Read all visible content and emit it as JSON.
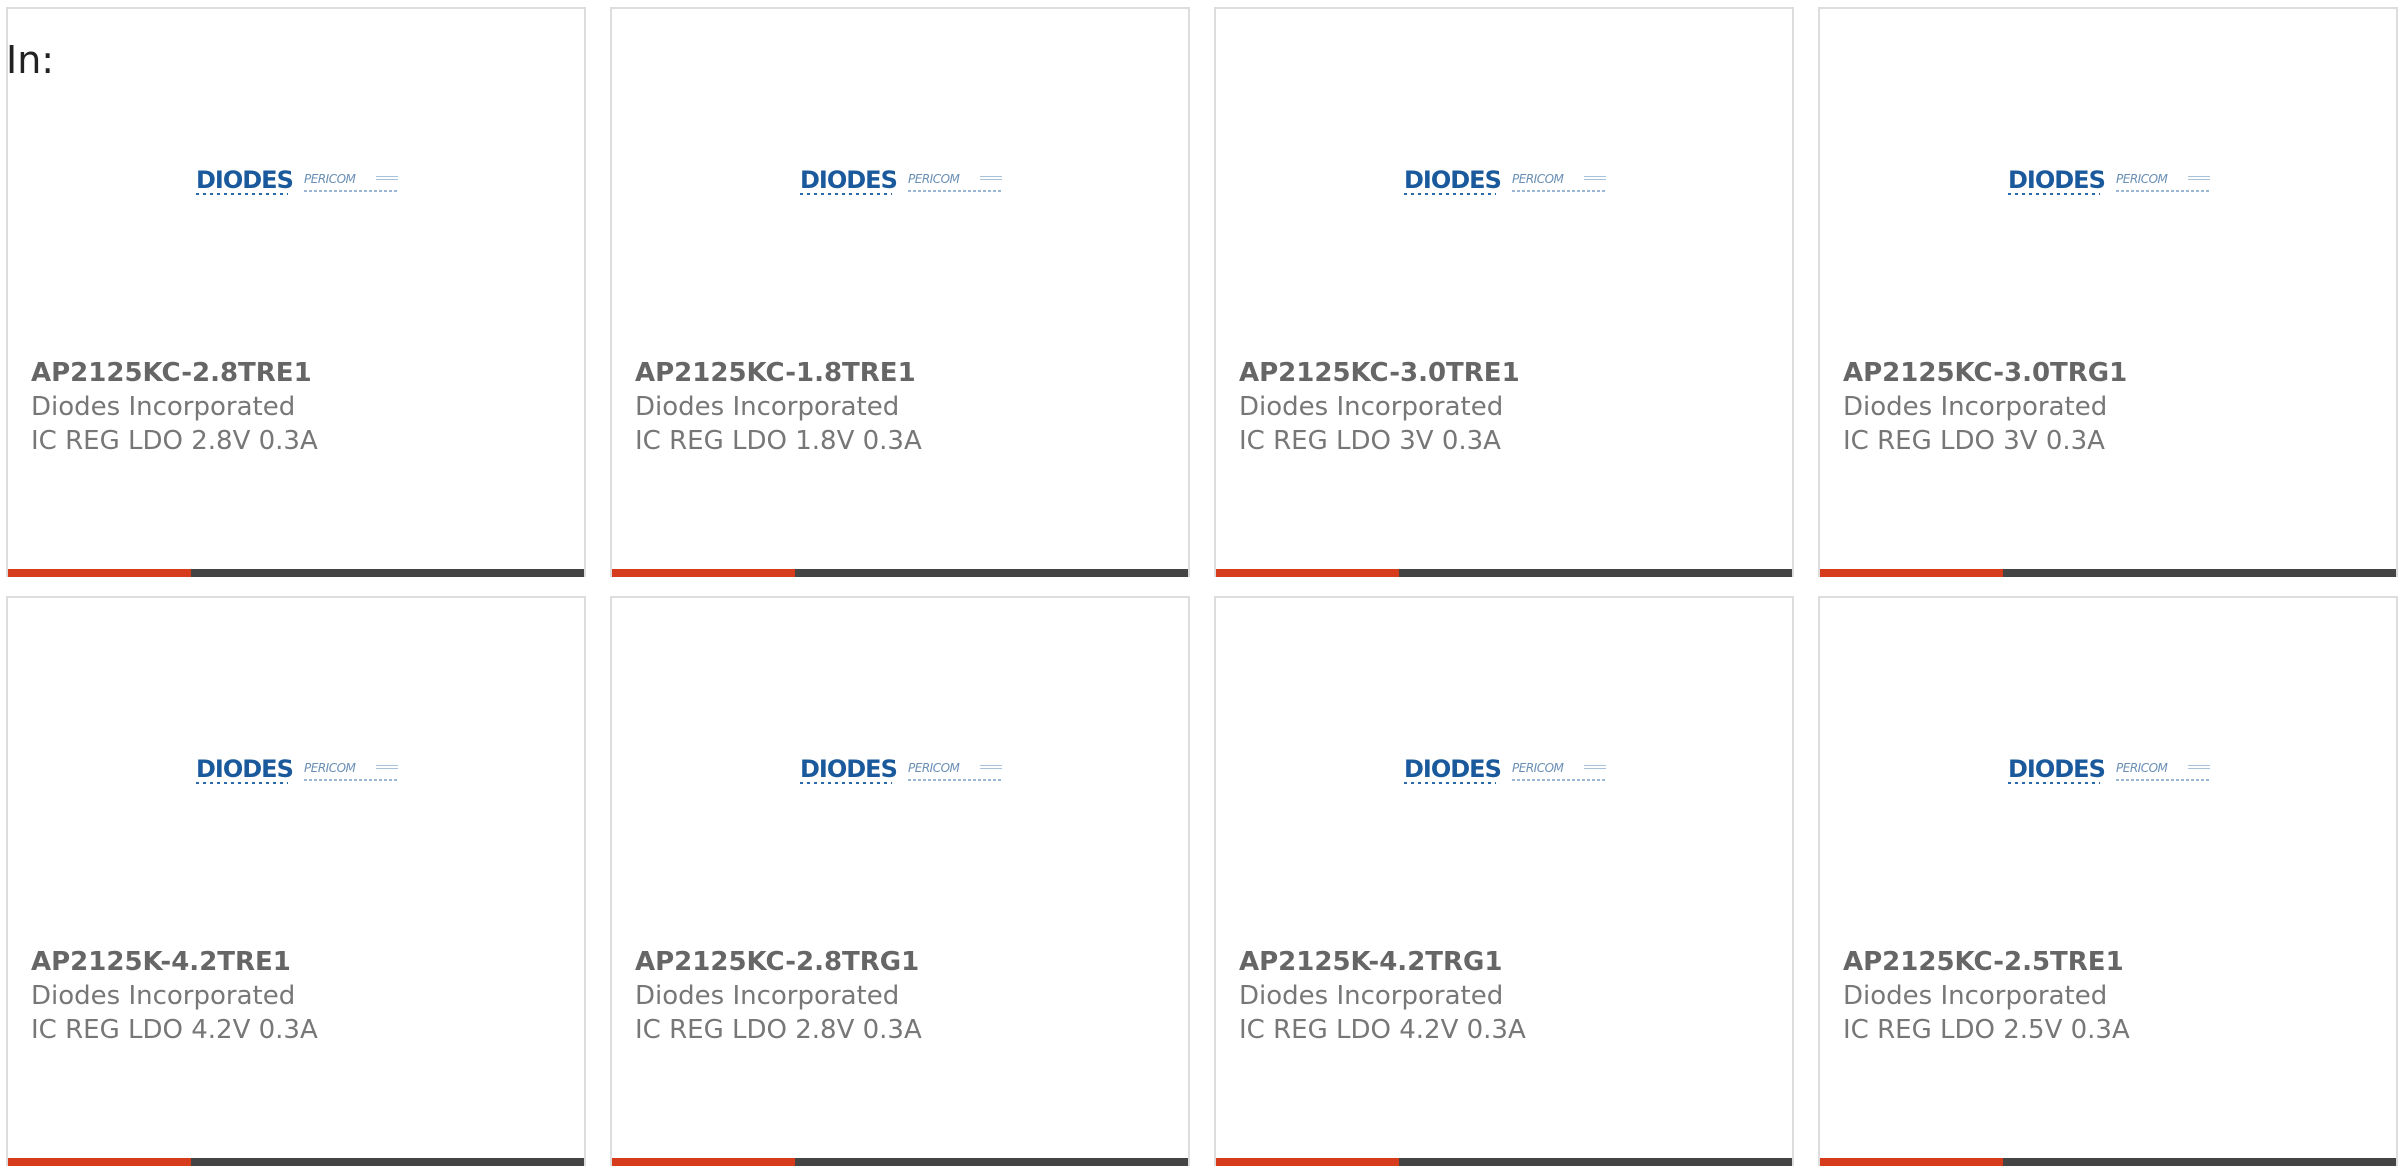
{
  "heading": "In:",
  "logo": {
    "main_text": "DIODES",
    "secondary_text": "PERICOM"
  },
  "colors": {
    "accent_bar": "#d63c1c",
    "bar": "#444444",
    "logo_blue": "#1a5a9c"
  },
  "products": [
    {
      "part": "AP2125KC-2.8TRE1",
      "maker": "Diodes Incorporated",
      "desc": "IC REG LDO 2.8V 0.3A"
    },
    {
      "part": "AP2125KC-1.8TRE1",
      "maker": "Diodes Incorporated",
      "desc": "IC REG LDO 1.8V 0.3A"
    },
    {
      "part": "AP2125KC-3.0TRE1",
      "maker": "Diodes Incorporated",
      "desc": "IC REG LDO 3V 0.3A"
    },
    {
      "part": "AP2125KC-3.0TRG1",
      "maker": "Diodes Incorporated",
      "desc": "IC REG LDO 3V 0.3A"
    },
    {
      "part": "AP2125K-4.2TRE1",
      "maker": "Diodes Incorporated",
      "desc": "IC REG LDO 4.2V 0.3A"
    },
    {
      "part": "AP2125KC-2.8TRG1",
      "maker": "Diodes Incorporated",
      "desc": "IC REG LDO 2.8V 0.3A"
    },
    {
      "part": "AP2125K-4.2TRG1",
      "maker": "Diodes Incorporated",
      "desc": "IC REG LDO 4.2V 0.3A"
    },
    {
      "part": "AP2125KC-2.5TRE1",
      "maker": "Diodes Incorporated",
      "desc": "IC REG LDO 2.5V 0.3A"
    }
  ]
}
